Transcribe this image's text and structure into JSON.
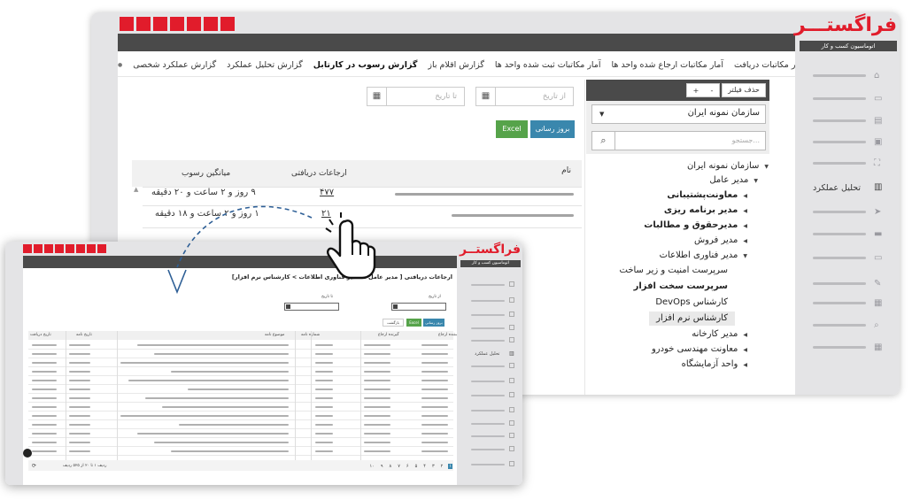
{
  "main": {
    "tabs": [
      {
        "label": "گزارش عملکرد شخصی",
        "active": false
      },
      {
        "label": "گزارش تحلیل عملکرد",
        "active": false
      },
      {
        "label": "گزارش رسوب در کارتابل",
        "active": true
      },
      {
        "label": "گزارش اقلام باز",
        "active": false
      },
      {
        "label": "آمار مکاتبات ثبت شده واحد ها",
        "active": false
      },
      {
        "label": "آمار مکاتبات ارجاع شده واحد ها",
        "active": false
      },
      {
        "label": "آمار مکاتبات دریافت",
        "active": false
      }
    ],
    "filter": {
      "delete_filter_label": "حذف فیلتر",
      "plus_label": "+",
      "minus_label": "-",
      "org_select_value": "سازمان نمونه ایران",
      "search_placeholder": "جستجو..."
    },
    "dates": {
      "from_placeholder": "از تاریخ",
      "to_placeholder": "تا تاریخ"
    },
    "buttons": {
      "update_label": "بروز رسانی",
      "excel_label": "Excel"
    },
    "table": {
      "headers": {
        "name": "نام",
        "received": "ارجاعات دریافتی",
        "avg": "میانگین رسوب"
      },
      "rows": [
        {
          "received": "۴۷۷",
          "avg": "۹ روز و ۲ ساعت و ۲۰ دقیقه"
        },
        {
          "received": "۲۱",
          "avg": "۱ روز و ۲ ساعت و ۱۸ دقیقه"
        }
      ]
    },
    "tree": [
      {
        "label": "سازمان نمونه ایران",
        "bold": false,
        "arrow": "▾"
      },
      {
        "label": "مدیر عامل",
        "bold": false,
        "arrow": "▾"
      },
      {
        "label": "معاونت‌پشتیبانی",
        "bold": true,
        "arrow": "◂"
      },
      {
        "label": "مدیر برنامه ریزی",
        "bold": true,
        "arrow": "◂"
      },
      {
        "label": "مدیرحقوق و مطالبات",
        "bold": true,
        "arrow": "◂"
      },
      {
        "label": "مدیر فروش",
        "bold": false,
        "arrow": "◂"
      },
      {
        "label": "مدیر فناوری اطلاعات",
        "bold": false,
        "arrow": "▾"
      },
      {
        "label": "سرپرست امنیت و زیر ساخت",
        "bold": false,
        "arrow": ""
      },
      {
        "label": "سرپرست سخت افزار",
        "bold": true,
        "arrow": ""
      },
      {
        "label": "کارشناس DevOps",
        "bold": false,
        "arrow": ""
      },
      {
        "label": "کارشناس نرم افزار",
        "bold": false,
        "arrow": "",
        "selected": true
      },
      {
        "label": "مدیر کارخانه",
        "bold": false,
        "arrow": "◂"
      },
      {
        "label": "معاونت مهندسی خودرو",
        "bold": false,
        "arrow": "◂"
      },
      {
        "label": "واحد آزمایشگاه",
        "bold": false,
        "arrow": "◂"
      }
    ],
    "sidebar": {
      "logo": "فراگستـــر",
      "logo_sub": "اتوماسیون کسب و کار",
      "active_item": "تحلیل عملکرد",
      "icons": [
        "home-icon",
        "inbox-icon",
        "folder-icon",
        "archive-icon",
        "workflow-icon",
        "chart-icon",
        "send-icon",
        "card-icon",
        "message-icon",
        "edit-icon",
        "table-icon",
        "search-icon",
        "calendar-icon"
      ]
    }
  },
  "sub": {
    "breadcrumb": "ارجاعات دریافتی [ مدیر عامل > مدیر فناوری اطلاعات > کارشناس نرم افزار]",
    "logo": "فراگستــر",
    "logo_sub": "اتوماسیون کسب و کار",
    "from_label": "از تاریخ",
    "to_label": "تا تاریخ",
    "update_label": "بروز رسانی",
    "excel_label": "Excel",
    "back_label": "بازگشت",
    "active_item": "تحلیل عملکرد",
    "headers": [
      "فرستنده ارجاع",
      "گیرنده ارجاع",
      "شماره نامه",
      "موضوع نامه",
      "تاریخ نامه",
      "تاریخ دریافت"
    ],
    "pagination": [
      "۱",
      "۲",
      "۳",
      "۴",
      "۵",
      "۶",
      "۷",
      "۸",
      "۹",
      "۱۰"
    ],
    "footer_info": "ردیف ۱ تا ۲۰ از ۵۲۵ ردیف"
  },
  "colors": {
    "brand_red": "#e11c2b",
    "dark_bar": "#4a4a4a",
    "sidebar_bg": "#e4e4e6",
    "update_blue": "#3a87ad",
    "excel_green": "#56a34a"
  }
}
